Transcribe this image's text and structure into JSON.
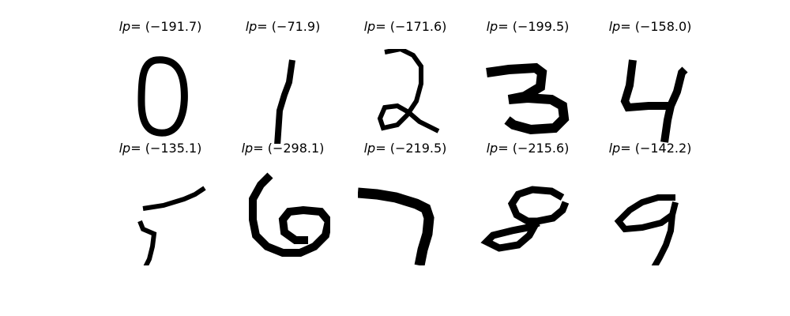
{
  "figure": {
    "panels": [
      {
        "label": "lp",
        "value": "= (−191.7)",
        "digit": "0"
      },
      {
        "label": "lp",
        "value": "= (−71.9)",
        "digit": "1"
      },
      {
        "label": "lp",
        "value": "= (−171.6)",
        "digit": "2"
      },
      {
        "label": "lp",
        "value": "= (−199.5)",
        "digit": "3"
      },
      {
        "label": "lp",
        "value": "= (−158.0)",
        "digit": "4"
      },
      {
        "label": "lp",
        "value": "= (−135.1)",
        "digit": "5"
      },
      {
        "label": "lp",
        "value": "= (−298.1)",
        "digit": "6"
      },
      {
        "label": "lp",
        "value": "= (−219.5)",
        "digit": "7"
      },
      {
        "label": "lp",
        "value": "= (−215.6)",
        "digit": "8"
      },
      {
        "label": "lp",
        "value": "= (−142.2)",
        "digit": "9"
      }
    ]
  }
}
